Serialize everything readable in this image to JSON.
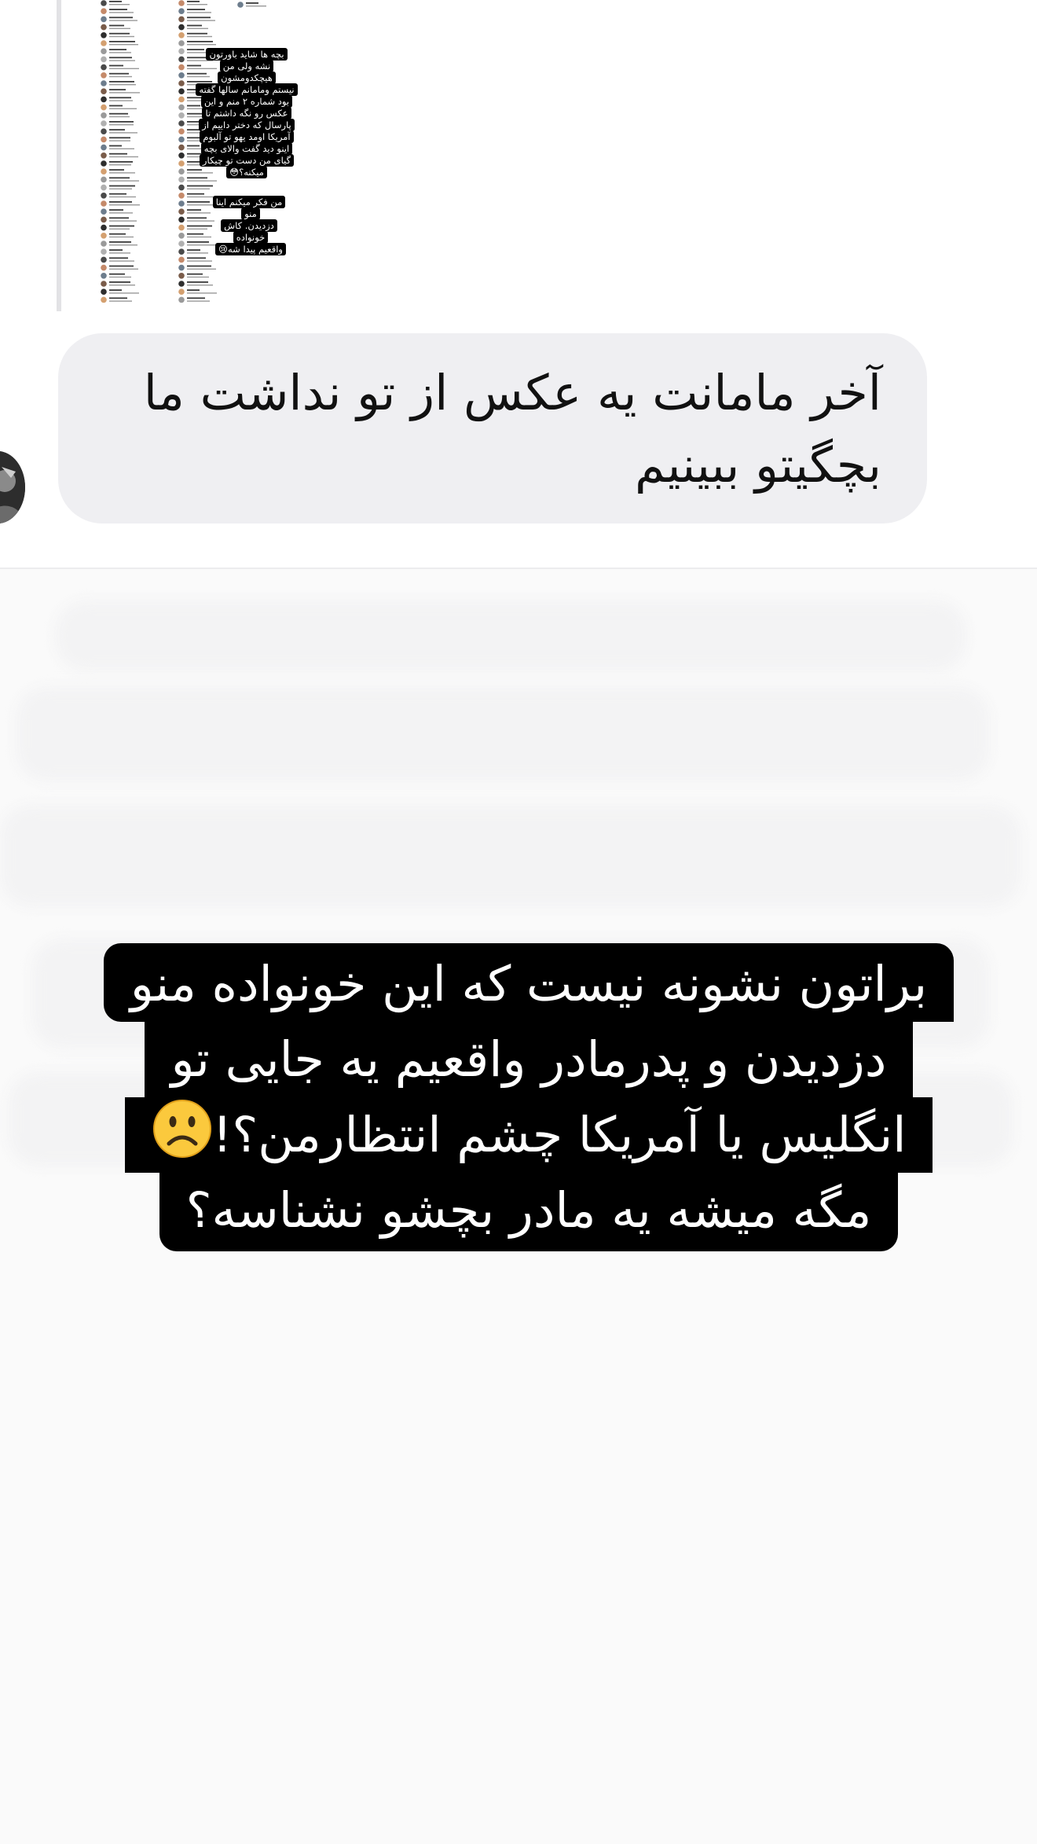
{
  "shared_story_preview": {
    "caption_lines": [
      "بچه ها شاید باورتون",
      "نشه ولی من",
      "هیچکدومشون",
      "نیستم ومامانم سالها گفته",
      "بود شماره ۲ منم و این",
      "عکس رو نگه داشتم تا",
      "پارسال که دختر داییم از",
      "آمریکا اومد یهو تو آلبوم",
      "اینو دید گفت والای بچه",
      "گیای من دست تو چیکار",
      "میکنه؟😳"
    ],
    "caption_lines_2": [
      "من فکر میکنم اینا منو",
      "دزدیدن. کاش خونواده",
      "واقعیم پیدا شه😢"
    ]
  },
  "reply_message": {
    "text": "آخر مامانت یه عکس از تو نداشت ما بچگیتو ببینیم",
    "avatar_icon": "user-avatar-icon"
  },
  "story": {
    "caption_lines": [
      "براتون نشونه نیست که این خونواده منو",
      "دزدیدن و پدرمادر واقعیم یه جایی تو",
      "انگلیس یا آمریکا چشم انتظارمن؟!",
      "مگه میشه یه مادر بچشو نشناسه؟"
    ],
    "emoji": "frowning-face-icon"
  },
  "colors": {
    "bubble_bg": "#efeff2",
    "caption_bg": "#000000",
    "caption_text": "#ffffff",
    "story_bg": "#fafafa"
  }
}
